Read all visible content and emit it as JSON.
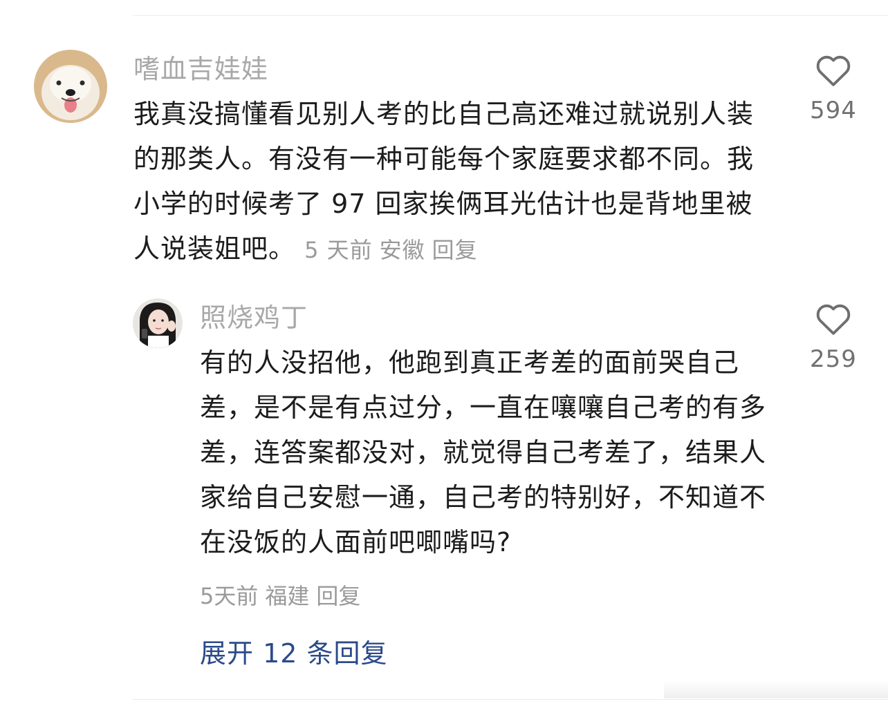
{
  "comment": {
    "username": "嗜血吉娃娃",
    "text": "我真没搞懂看见别人考的比自己高还难过就说别人装的那类人。有没有一种可能每个家庭要求都不同。我小学的时候考了 97 回家挨俩耳光估计也是背地里被人说装姐吧。",
    "time": "5 天前",
    "location": "安徽",
    "reply_label": "回复",
    "likes": "594",
    "avatar_icon": "dog-avatar"
  },
  "reply": {
    "username": "照烧鸡丁",
    "text": "有的人没招他，他跑到真正考差的面前哭自己差，是不是有点过分，一直在嚷嚷自己考的有多差，连答案都没对，就觉得自己考差了，结果人家给自己安慰一通，自己考的特别好，不知道不在没饭的人面前吧唧嘴吗?",
    "time": "5天前",
    "location": "福建",
    "reply_label": "回复",
    "likes": "259",
    "avatar_icon": "girl-avatar"
  },
  "expand_label": "展开 12 条回复",
  "colors": {
    "username": "#a8a8a8",
    "meta": "#9a9a9a",
    "link": "#2b4a8a",
    "text": "#1c1c1c"
  }
}
